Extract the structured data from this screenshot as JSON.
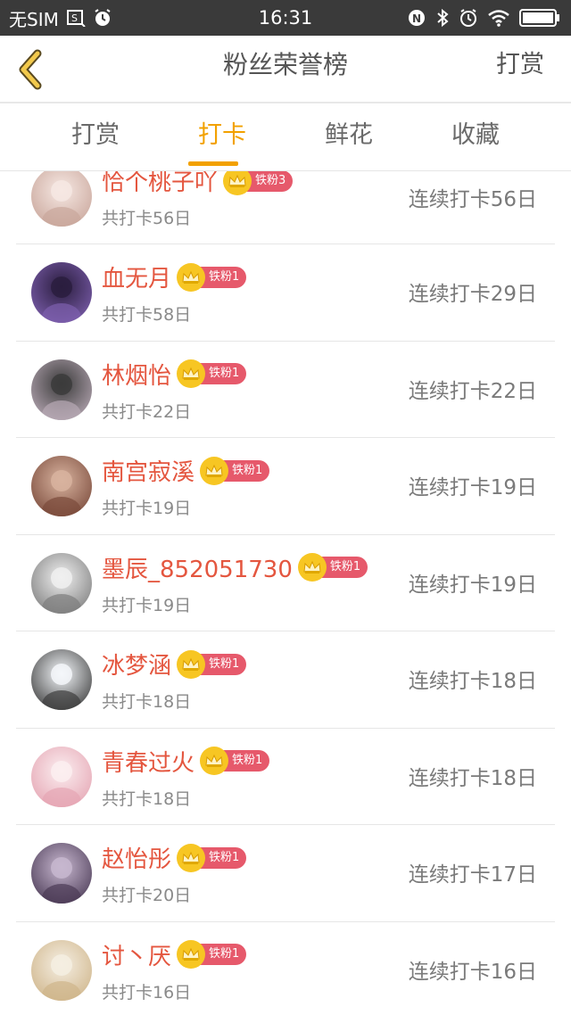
{
  "status_bar": {
    "carrier": "无SIM",
    "time": "16:31"
  },
  "header": {
    "title": "粉丝荣誉榜",
    "action": "打赏"
  },
  "tabs": [
    {
      "label": "打赏",
      "active": false
    },
    {
      "label": "打卡",
      "active": true
    },
    {
      "label": "鲜花",
      "active": false
    },
    {
      "label": "收藏",
      "active": false
    }
  ],
  "colors": {
    "accent": "#f2a100",
    "name": "#e4563f",
    "badge": "#e6596b",
    "crown": "#f7c623"
  },
  "fans": [
    {
      "name": "恰个桃子吖",
      "badge": "铁粉3",
      "total": "共打卡56日",
      "streak": "连续打卡56日",
      "avatar_colors": [
        "#f6e8e3",
        "#c9a69b"
      ]
    },
    {
      "name": "血无月",
      "badge": "铁粉1",
      "total": "共打卡58日",
      "streak": "连续打卡29日",
      "avatar_colors": [
        "#2a1d3e",
        "#7d5fae"
      ]
    },
    {
      "name": "林烟怡",
      "badge": "铁粉1",
      "total": "共打卡22日",
      "streak": "连续打卡22日",
      "avatar_colors": [
        "#3b3b3b",
        "#b8a9b5"
      ]
    },
    {
      "name": "南宫寂溪",
      "badge": "铁粉1",
      "total": "共打卡19日",
      "streak": "连续打卡19日",
      "avatar_colors": [
        "#d8b39f",
        "#7a4a3b"
      ]
    },
    {
      "name": "墨辰_852051730",
      "badge": "铁粉1",
      "total": "共打卡19日",
      "streak": "连续打卡19日",
      "avatar_colors": [
        "#f0f0f0",
        "#7d7d7d"
      ]
    },
    {
      "name": "冰梦涵",
      "badge": "铁粉1",
      "total": "共打卡18日",
      "streak": "连续打卡18日",
      "avatar_colors": [
        "#f4f7fa",
        "#3d3d3d"
      ]
    },
    {
      "name": "青春过火",
      "badge": "铁粉1",
      "total": "共打卡18日",
      "streak": "连续打卡18日",
      "avatar_colors": [
        "#fbeef0",
        "#e5a5b3"
      ]
    },
    {
      "name": "赵怡彤",
      "badge": "铁粉1",
      "total": "共打卡20日",
      "streak": "连续打卡17日",
      "avatar_colors": [
        "#c7b7cf",
        "#4b3b56"
      ]
    },
    {
      "name": "讨丶厌",
      "badge": "铁粉1",
      "total": "共打卡16日",
      "streak": "连续打卡16日",
      "avatar_colors": [
        "#f5eee2",
        "#cfb58a"
      ]
    }
  ]
}
